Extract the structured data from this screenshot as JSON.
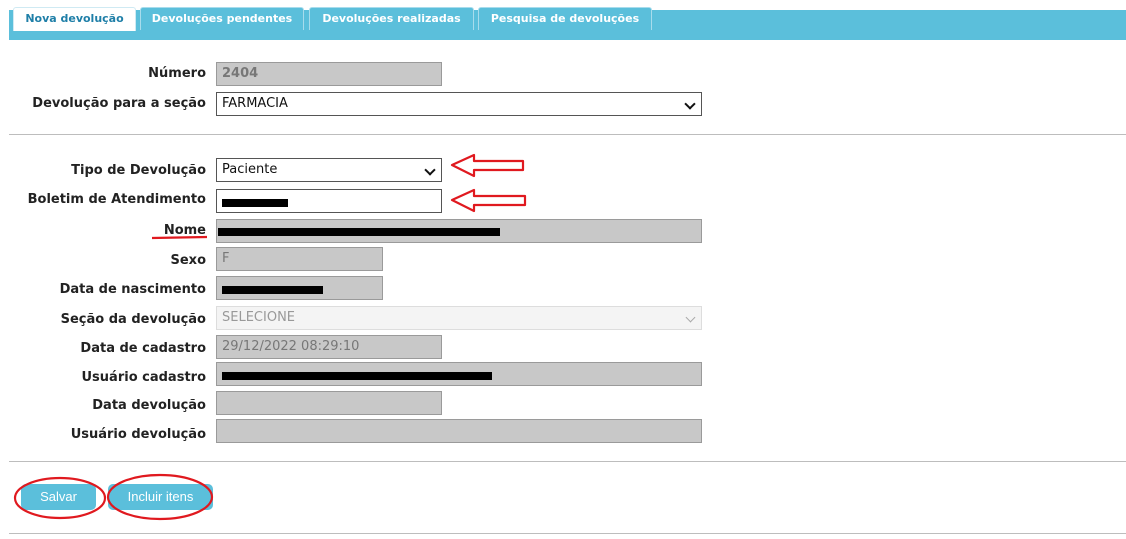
{
  "tabs": [
    {
      "label": "Nova devolução",
      "active": true
    },
    {
      "label": "Devoluções pendentes",
      "active": false
    },
    {
      "label": "Devoluções realizadas",
      "active": false
    },
    {
      "label": "Pesquisa de devoluções",
      "active": false
    }
  ],
  "form": {
    "numero": {
      "label": "Número",
      "value": "2404"
    },
    "secao_destino": {
      "label": "Devolução para a seção",
      "value": "FARMACIA"
    },
    "tipo": {
      "label": "Tipo de Devolução",
      "value": "Paciente"
    },
    "boletim": {
      "label": "Boletim de Atendimento",
      "value": ""
    },
    "nome": {
      "label": "Nome",
      "value": ""
    },
    "sexo": {
      "label": "Sexo",
      "value": "F"
    },
    "nascimento": {
      "label": "Data de nascimento",
      "value": ""
    },
    "secao_devolucao": {
      "label": "Seção da devolução",
      "value": "SELECIONE"
    },
    "data_cadastro": {
      "label": "Data de cadastro",
      "value": "29/12/2022 08:29:10"
    },
    "usuario_cadastro": {
      "label": "Usuário cadastro",
      "value": ""
    },
    "data_devolucao": {
      "label": "Data devolução",
      "value": ""
    },
    "usuario_devolucao": {
      "label": "Usuário devolução",
      "value": ""
    }
  },
  "buttons": {
    "save": "Salvar",
    "include_items": "Incluir itens"
  },
  "colors": {
    "accent": "#5bbfdb",
    "annotation": "#e0191f"
  }
}
